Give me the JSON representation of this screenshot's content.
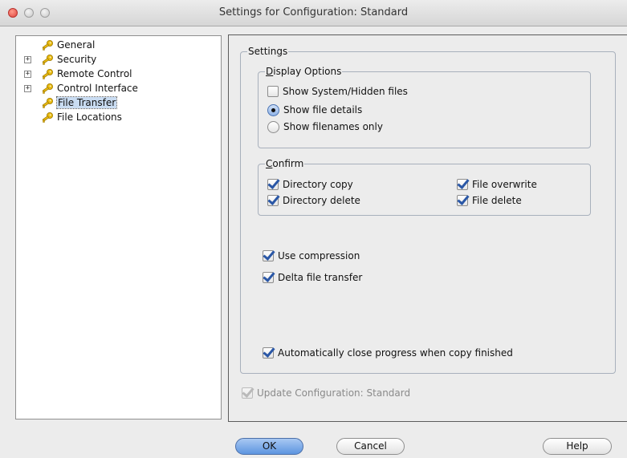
{
  "window": {
    "title": "Settings for Configuration: Standard"
  },
  "tree": {
    "items": [
      {
        "label": "General",
        "expandable": false,
        "selected": false
      },
      {
        "label": "Security",
        "expandable": true,
        "selected": false
      },
      {
        "label": "Remote Control",
        "expandable": true,
        "selected": false
      },
      {
        "label": "Control Interface",
        "expandable": true,
        "selected": false
      },
      {
        "label": "File Transfer",
        "expandable": false,
        "selected": true
      },
      {
        "label": "File Locations",
        "expandable": false,
        "selected": false
      }
    ],
    "expander_glyph": "+",
    "icon": "key-icon"
  },
  "settings": {
    "group_label": "Settings",
    "display_options": {
      "label_key": "D",
      "label_rest": "isplay Options",
      "show_hidden": {
        "label": "Show System/Hidden files",
        "checked": false
      },
      "show_details": {
        "label": "Show file details",
        "selected": true
      },
      "show_names": {
        "label": "Show filenames only",
        "selected": false
      }
    },
    "confirm": {
      "label_key": "C",
      "label_rest": "onfirm",
      "directory_copy": {
        "label": "Directory copy",
        "checked": true
      },
      "directory_delete": {
        "label": "Directory delete",
        "checked": true
      },
      "file_overwrite": {
        "label": "File overwrite",
        "checked": true
      },
      "file_delete": {
        "label": "File delete",
        "checked": true
      }
    },
    "use_compression": {
      "label": "Use compression",
      "checked": true
    },
    "delta_transfer": {
      "label": "Delta file transfer",
      "checked": true
    },
    "auto_close": {
      "label": "Automatically close progress when copy finished",
      "checked": true
    }
  },
  "update_config": {
    "label": "Update Configuration: Standard",
    "checked": true,
    "enabled": false
  },
  "buttons": {
    "ok": "OK",
    "cancel": "Cancel",
    "help": "Help"
  },
  "colors": {
    "selection": "#c9dcf2",
    "default_button": "#5d95e0",
    "check_mark": "#2a57a6"
  }
}
